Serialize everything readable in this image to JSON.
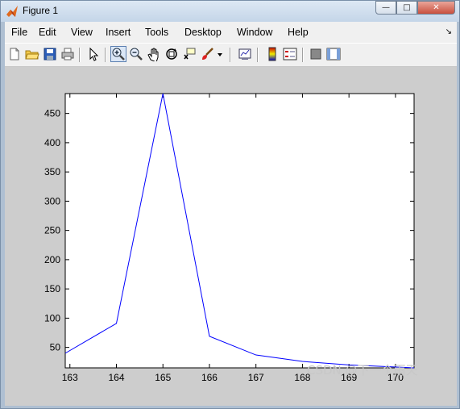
{
  "window": {
    "title": "Figure 1",
    "buttons": {
      "minimize": "—",
      "maximize": "□",
      "close": "✕"
    }
  },
  "menubar": {
    "items": [
      "File",
      "Edit",
      "View",
      "Insert",
      "Tools",
      "Desktop",
      "Window",
      "Help"
    ],
    "overflow_arrow": "↘"
  },
  "toolbar": {
    "icons": [
      "new-figure-icon",
      "open-file-icon",
      "save-icon",
      "print-icon",
      "edit-plot-arrow-icon",
      "zoom-in-icon",
      "zoom-out-icon",
      "pan-hand-icon",
      "rotate-3d-icon",
      "data-cursor-icon",
      "brush-icon",
      "brush-dropdown-icon",
      "link-plot-icon",
      "colorbar-icon",
      "legend-icon",
      "hide-plot-tools-icon",
      "show-plot-tools-icon"
    ],
    "active": "zoom-in-icon"
  },
  "colors": {
    "line": "#0000ff",
    "axes_bg": "#ffffff",
    "figure_bg": "#cdcdcd"
  },
  "chart_data": {
    "type": "line",
    "x": [
      162.9,
      164,
      165,
      166,
      167,
      168,
      169,
      170.4
    ],
    "y": [
      40,
      91,
      484,
      69,
      37,
      26,
      20,
      15
    ],
    "xlim": [
      162.9,
      170.4
    ],
    "ylim": [
      15,
      484
    ],
    "xticks": [
      163,
      164,
      165,
      166,
      167,
      168,
      169,
      170
    ],
    "xtick_labels": [
      "163",
      "164",
      "165",
      "166",
      "167",
      "168",
      "169",
      "170"
    ],
    "yticks": [
      50,
      100,
      150,
      200,
      250,
      300,
      350,
      400,
      450
    ],
    "ytick_labels": [
      "50",
      "100",
      "150",
      "200",
      "250",
      "300",
      "350",
      "400",
      "450"
    ],
    "grid": false,
    "title": "",
    "xlabel": "",
    "ylabel": ""
  },
  "watermark": "CSDN @下一个雨天"
}
